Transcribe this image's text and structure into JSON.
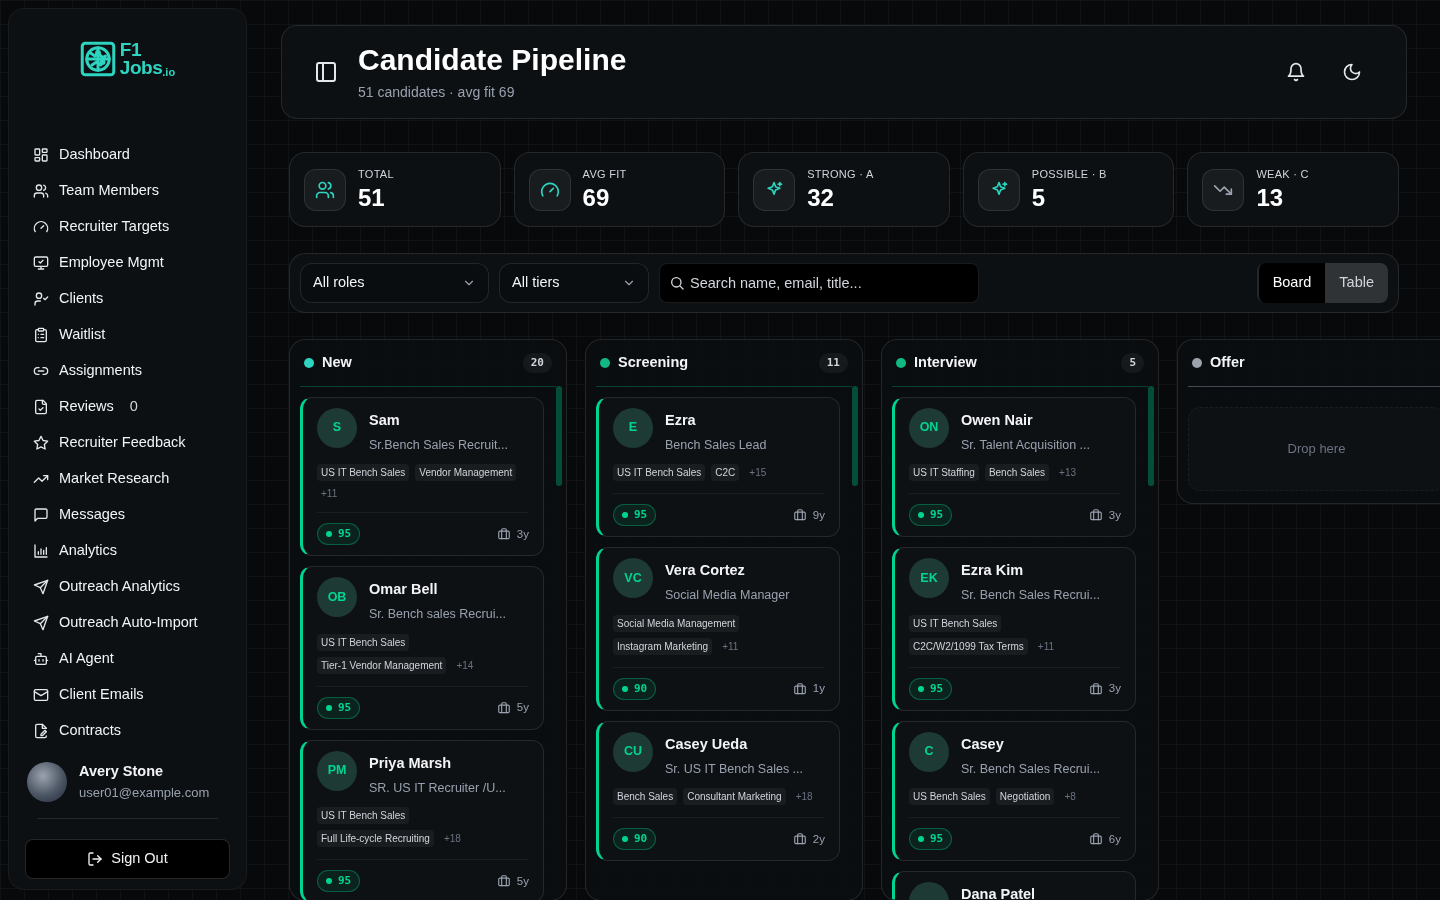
{
  "logo": {
    "line1": "F1",
    "line2": "Jobs",
    "suffix": ".io"
  },
  "nav": [
    {
      "label": "Dashboard"
    },
    {
      "label": "Team Members"
    },
    {
      "label": "Recruiter Targets"
    },
    {
      "label": "Employee Mgmt"
    },
    {
      "label": "Clients"
    },
    {
      "label": "Waitlist"
    },
    {
      "label": "Assignments"
    },
    {
      "label": "Reviews",
      "badge": "0"
    },
    {
      "label": "Recruiter Feedback"
    },
    {
      "label": "Market Research"
    },
    {
      "label": "Messages"
    },
    {
      "label": "Analytics"
    },
    {
      "label": "Outreach Analytics"
    },
    {
      "label": "Outreach Auto-Import"
    },
    {
      "label": "AI Agent"
    },
    {
      "label": "Client Emails"
    },
    {
      "label": "Contracts"
    }
  ],
  "user": {
    "name": "Avery Stone",
    "email": "user01@example.com"
  },
  "sign_out": "Sign Out",
  "header": {
    "title": "Candidate Pipeline",
    "subtitle": "51 candidates · avg fit 69"
  },
  "stats": [
    {
      "label": "TOTAL",
      "value": "51",
      "color": "#2dd4bf"
    },
    {
      "label": "AVG FIT",
      "value": "69",
      "color": "#2dd4bf"
    },
    {
      "label": "STRONG · A",
      "value": "32",
      "color": "#2dd4bf"
    },
    {
      "label": "POSSIBLE · B",
      "value": "5",
      "color": "#2dd4bf"
    },
    {
      "label": "WEAK · C",
      "value": "13",
      "color": "#9ca3af"
    }
  ],
  "filters": {
    "roles": "All roles",
    "tiers": "All tiers",
    "search_placeholder": "Search name, email, title..."
  },
  "views": [
    {
      "label": "Board",
      "selected": true
    },
    {
      "label": "Table",
      "selected": false
    }
  ],
  "columns": [
    {
      "name": "New",
      "count": "20",
      "color": "#2dd4bf",
      "cards": [
        {
          "initials": "S",
          "name": "Sam",
          "title": "Sr.Bench Sales Recruit...",
          "tags": [
            "US IT Bench Sales",
            "Vendor Management"
          ],
          "more": "+11",
          "score": "95",
          "years": "3y"
        },
        {
          "initials": "OB",
          "name": "Omar Bell",
          "title": "Sr. Bench sales Recrui...",
          "tags": [
            "US IT Bench Sales",
            "Tier-1 Vendor Management"
          ],
          "more": "+14",
          "score": "95",
          "years": "5y"
        },
        {
          "initials": "PM",
          "name": "Priya Marsh",
          "title": "SR. US IT Recruiter /U...",
          "tags": [
            "US IT Bench Sales",
            "Full Life-cycle Recruiting"
          ],
          "more": "+18",
          "score": "95",
          "years": "5y"
        }
      ]
    },
    {
      "name": "Screening",
      "count": "11",
      "color": "#10b981",
      "cards": [
        {
          "initials": "E",
          "name": "Ezra",
          "title": "Bench Sales Lead",
          "tags": [
            "US IT Bench Sales",
            "C2C"
          ],
          "more": "+15",
          "score": "95",
          "years": "9y"
        },
        {
          "initials": "VC",
          "name": "Vera Cortez",
          "title": "Social Media Manager",
          "tags": [
            "Social Media Management",
            "Instagram Marketing"
          ],
          "more": "+11",
          "score": "90",
          "years": "1y"
        },
        {
          "initials": "CU",
          "name": "Casey Ueda",
          "title": "Sr. US IT Bench Sales ...",
          "tags": [
            "Bench Sales",
            "Consultant Marketing"
          ],
          "more": "+18",
          "score": "90",
          "years": "2y"
        }
      ]
    },
    {
      "name": "Interview",
      "count": "5",
      "color": "#10b981",
      "cards": [
        {
          "initials": "ON",
          "name": "Owen Nair",
          "title": "Sr. Talent Acquisition ...",
          "tags": [
            "US IT Staffing",
            "Bench Sales"
          ],
          "more": "+13",
          "score": "95",
          "years": "3y"
        },
        {
          "initials": "EK",
          "name": "Ezra Kim",
          "title": "Sr. Bench Sales Recrui...",
          "tags": [
            "US IT Bench Sales",
            "C2C/W2/1099 Tax Terms"
          ],
          "more": "+11",
          "score": "95",
          "years": "3y"
        },
        {
          "initials": "C",
          "name": "Casey",
          "title": "Sr. Bench Sales Recrui...",
          "tags": [
            "US Bench Sales",
            "Negotiation"
          ],
          "more": "+8",
          "score": "95",
          "years": "6y"
        },
        {
          "name": "Dana Patel"
        }
      ]
    },
    {
      "name": "Offer",
      "color": "#9ca3af",
      "empty_text": "Drop here"
    }
  ]
}
